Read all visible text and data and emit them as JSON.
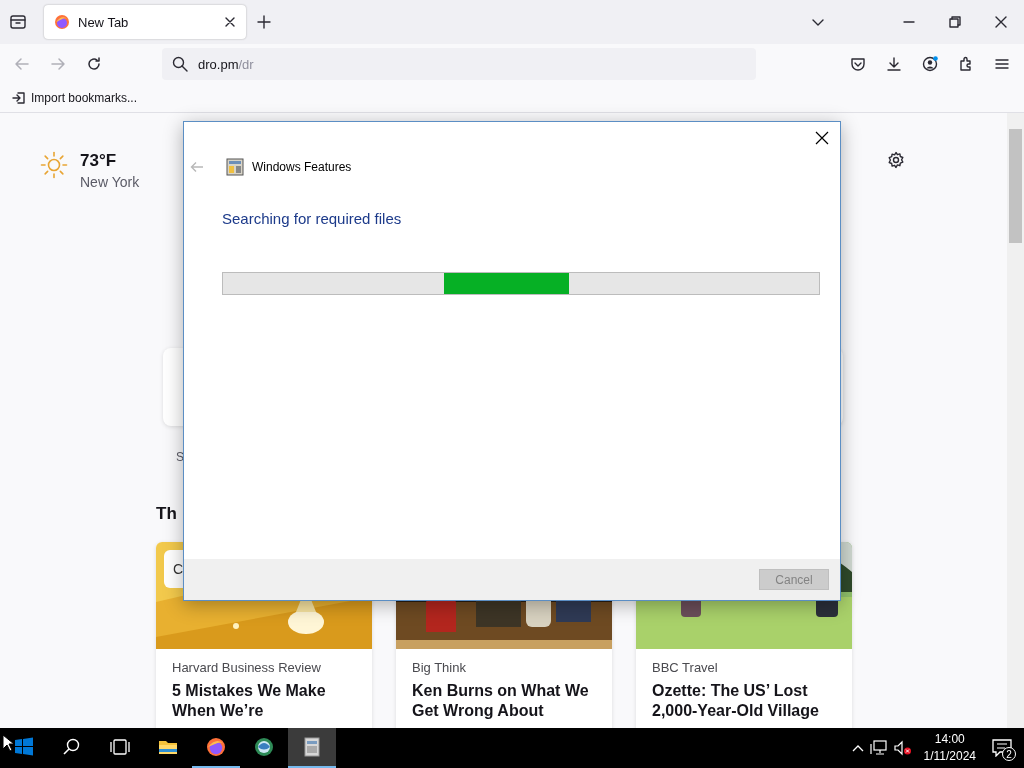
{
  "browser": {
    "tabs": [
      {
        "title": "New Tab",
        "selected": true
      }
    ],
    "nav": [
      {
        "kind": "back",
        "disabled": true
      },
      {
        "kind": "forward",
        "disabled": true
      },
      {
        "kind": "reload",
        "disabled": false
      }
    ],
    "address": {
      "host": "dro.pm",
      "path": "/dr"
    },
    "bookmarks": [
      {
        "label": "Import bookmarks..."
      }
    ]
  },
  "new_tab": {
    "weather": {
      "temperature": "73°F",
      "location": "New York"
    },
    "shortcut_label": "S",
    "section_heading": "Th",
    "stories": [
      {
        "badge": "C",
        "source": "Harvard Business Review",
        "title": "5 Mistakes We Make When We’re"
      },
      {
        "source": "Big Think",
        "title": "Ken Burns on What We Get Wrong About"
      },
      {
        "source": "BBC Travel",
        "title": "Ozette: The US’ Lost 2,000-Year-Old Village"
      }
    ]
  },
  "dialog": {
    "title": "Windows Features",
    "back_disabled": true,
    "heading": "Searching for required files",
    "progress": {
      "kind": "marquee"
    },
    "buttons": [
      {
        "label": "Cancel",
        "disabled": true
      }
    ]
  },
  "taskbar": {
    "apps": [
      {
        "kind": "start",
        "running": false,
        "active": false
      },
      {
        "kind": "search",
        "running": false,
        "active": false
      },
      {
        "kind": "task-view",
        "running": false,
        "active": false
      },
      {
        "kind": "explorer",
        "running": false,
        "active": false
      },
      {
        "kind": "firefox",
        "running": true,
        "active": false
      },
      {
        "kind": "globe",
        "running": false,
        "active": false
      },
      {
        "kind": "features",
        "running": true,
        "active": true
      }
    ],
    "clock": {
      "time": "14:00",
      "date": "1/11/2024"
    },
    "notifications": "2"
  }
}
